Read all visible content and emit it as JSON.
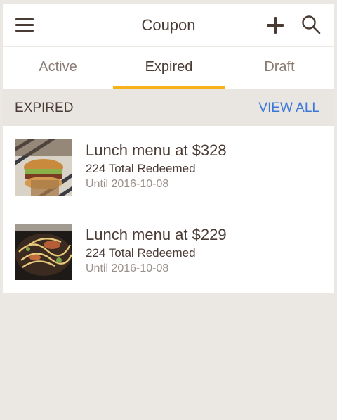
{
  "header": {
    "title": "Coupon",
    "menu_icon": "hamburger-menu-icon",
    "add_icon": "plus-icon",
    "search_icon": "search-icon"
  },
  "tabs": [
    {
      "label": "Active",
      "active": false
    },
    {
      "label": "Expired",
      "active": true
    },
    {
      "label": "Draft",
      "active": false
    }
  ],
  "section": {
    "title": "EXPIRED",
    "view_all": "VIEW ALL"
  },
  "coupons": [
    {
      "title": "Lunch menu at $328",
      "redeemed": "224 Total Redeemed",
      "until": "Until 2016-10-08",
      "image": "burger-photo"
    },
    {
      "title": "Lunch menu at $229",
      "redeemed": "224 Total Redeemed",
      "until": "Until 2016-10-08",
      "image": "pasta-photo"
    }
  ],
  "colors": {
    "accent": "#f5b21b",
    "link": "#3b78d8",
    "text": "#4a3b35",
    "muted": "#9a908b",
    "background": "#ebe8e4"
  }
}
